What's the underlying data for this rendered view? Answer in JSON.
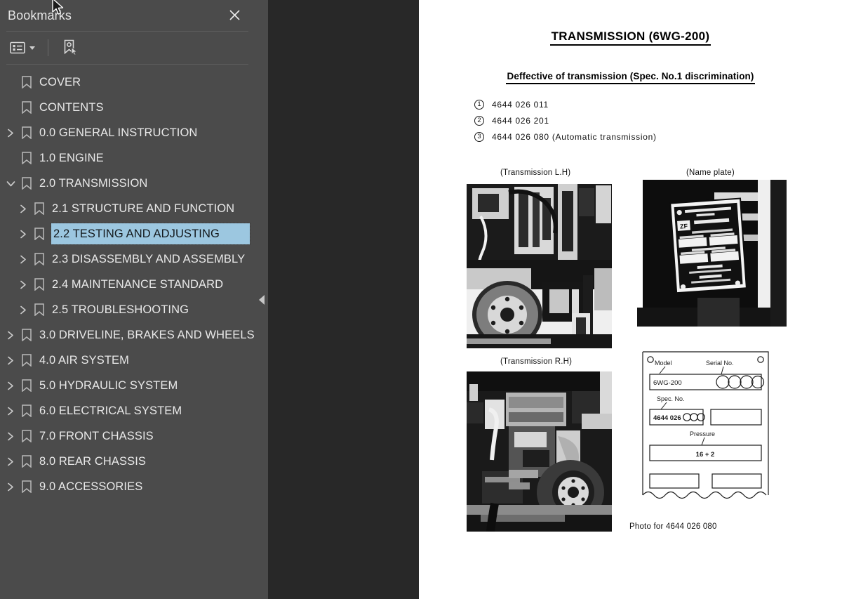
{
  "panel": {
    "title": "Bookmarks",
    "close_icon": "close-icon",
    "toolbar": {
      "options_icon": "list-options-icon",
      "new_bookmark_icon": "new-bookmark-icon"
    },
    "collapse_icon": "collapse-left-icon"
  },
  "bookmarks": [
    {
      "label": "COVER",
      "depth": 0,
      "twisty": "none",
      "selected": false
    },
    {
      "label": "CONTENTS",
      "depth": 0,
      "twisty": "none",
      "selected": false
    },
    {
      "label": "0.0 GENERAL INSTRUCTION",
      "depth": 0,
      "twisty": "collapsed",
      "selected": false
    },
    {
      "label": "1.0 ENGINE",
      "depth": 0,
      "twisty": "none",
      "selected": false
    },
    {
      "label": "2.0 TRANSMISSION",
      "depth": 0,
      "twisty": "expanded",
      "selected": false
    },
    {
      "label": "2.1 STRUCTURE AND FUNCTION",
      "depth": 1,
      "twisty": "collapsed",
      "selected": false
    },
    {
      "label": "2.2 TESTING AND ADJUSTING",
      "depth": 1,
      "twisty": "collapsed",
      "selected": true
    },
    {
      "label": "2.3 DISASSEMBLY AND ASSEMBLY",
      "depth": 1,
      "twisty": "collapsed",
      "selected": false
    },
    {
      "label": "2.4 MAINTENANCE STANDARD",
      "depth": 1,
      "twisty": "collapsed",
      "selected": false
    },
    {
      "label": "2.5 TROUBLESHOOTING",
      "depth": 1,
      "twisty": "collapsed",
      "selected": false
    },
    {
      "label": "3.0 DRIVELINE, BRAKES AND WHEELS",
      "depth": 0,
      "twisty": "collapsed",
      "selected": false
    },
    {
      "label": "4.0 AIR SYSTEM",
      "depth": 0,
      "twisty": "collapsed",
      "selected": false
    },
    {
      "label": "5.0 HYDRAULIC SYSTEM",
      "depth": 0,
      "twisty": "collapsed",
      "selected": false
    },
    {
      "label": "6.0 ELECTRICAL SYSTEM",
      "depth": 0,
      "twisty": "collapsed",
      "selected": false
    },
    {
      "label": "7.0 FRONT CHASSIS",
      "depth": 0,
      "twisty": "collapsed",
      "selected": false
    },
    {
      "label": "8.0 REAR CHASSIS",
      "depth": 0,
      "twisty": "collapsed",
      "selected": false
    },
    {
      "label": "9.0 ACCESSORIES",
      "depth": 0,
      "twisty": "collapsed",
      "selected": false
    }
  ],
  "document": {
    "title": "TRANSMISSION  (6WG-200)",
    "subtitle": "Deffective of transmission (Spec. No.1 discrimination)",
    "spec_items": [
      {
        "num": "1",
        "text": "4644  026  011"
      },
      {
        "num": "2",
        "text": "4644  026  201"
      },
      {
        "num": "3",
        "text": "4644  026  080  (Automatic transmission)"
      }
    ],
    "captions": {
      "transmission_lh": "(Transmission L.H)",
      "transmission_rh": "(Transmission R.H)",
      "name_plate": "(Name plate)",
      "photo_for": "Photo for  4644  026  080"
    },
    "plate_form": {
      "model_label": "Model",
      "model_value": "6WG-200",
      "serial_label": "Serial No.",
      "spec_label": "Spec. No.",
      "spec_value": "4644  026",
      "pressure_label": "Pressure",
      "pressure_value": "16 + 2"
    }
  },
  "colors": {
    "sidebar_bg": "#4b4b4b",
    "viewer_bg": "#282828",
    "selection": "#9cc7e0",
    "page_bg": "#ffffff"
  }
}
